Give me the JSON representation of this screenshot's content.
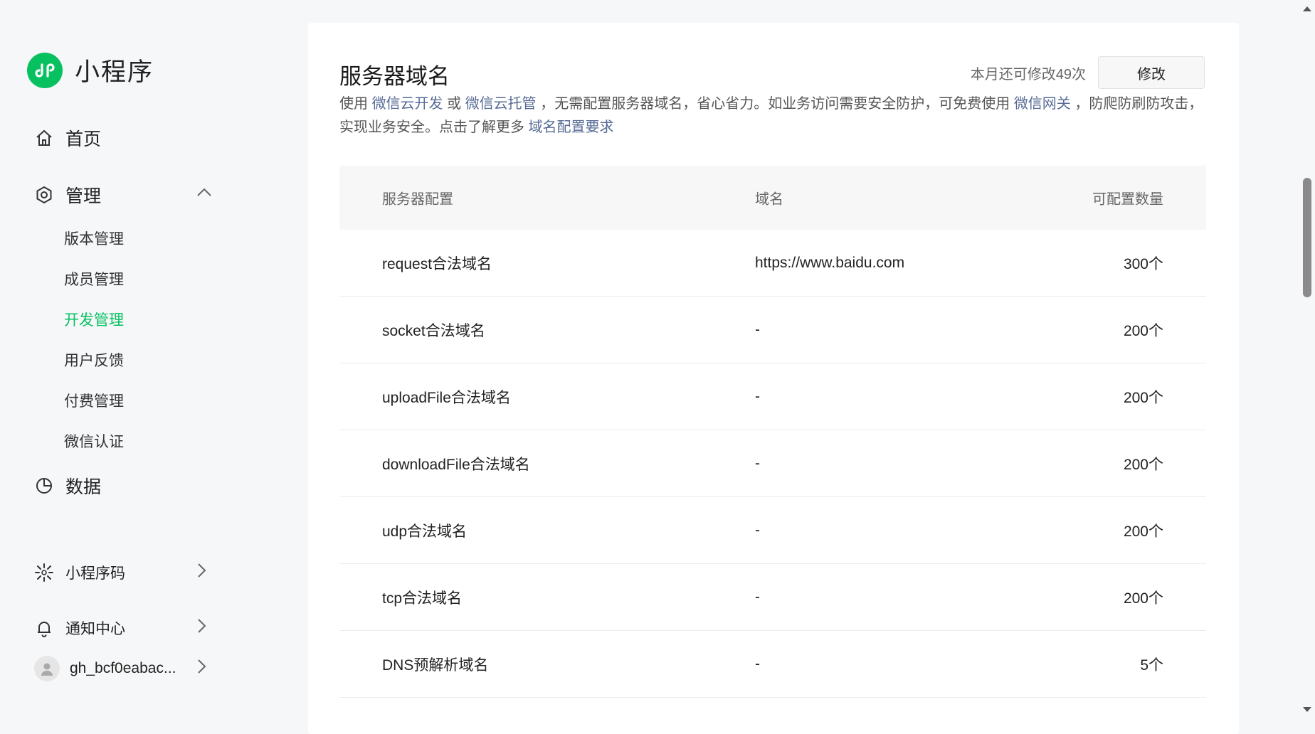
{
  "sidebar": {
    "brand": "小程序",
    "nav": {
      "home": "首页",
      "manage": "管理",
      "data": "数据"
    },
    "manage_items": [
      "版本管理",
      "成员管理",
      "开发管理",
      "用户反馈",
      "付费管理",
      "微信认证"
    ],
    "bottom": {
      "qrcode": "小程序码",
      "notice": "通知中心",
      "account": "gh_bcf0eabac..."
    }
  },
  "main": {
    "title": "服务器域名",
    "quota_text": "本月还可修改49次",
    "edit_button": "修改",
    "desc": {
      "p1": "使用 ",
      "link1": "微信云开发",
      "p2": " 或 ",
      "link2": "微信云托管",
      "p3": " ，无需配置服务器域名，省心省力。如业务访问需要安全防护，可免费使用 ",
      "link3": "微信网关",
      "p4": " ，防爬防刷防攻击，实现业务安全。点击了解更多 ",
      "link4": "域名配置要求"
    },
    "table": {
      "headers": [
        "服务器配置",
        "域名",
        "可配置数量"
      ],
      "rows": [
        {
          "config": "request合法域名",
          "domain": "https://www.baidu.com",
          "count": "300个"
        },
        {
          "config": "socket合法域名",
          "domain": "-",
          "count": "200个"
        },
        {
          "config": "uploadFile合法域名",
          "domain": "-",
          "count": "200个"
        },
        {
          "config": "downloadFile合法域名",
          "domain": "-",
          "count": "200个"
        },
        {
          "config": "udp合法域名",
          "domain": "-",
          "count": "200个"
        },
        {
          "config": "tcp合法域名",
          "domain": "-",
          "count": "200个"
        },
        {
          "config": "DNS预解析域名",
          "domain": "-",
          "count": "5个"
        }
      ]
    }
  },
  "colors": {
    "accent": "#07c160",
    "link": "#576b95"
  }
}
